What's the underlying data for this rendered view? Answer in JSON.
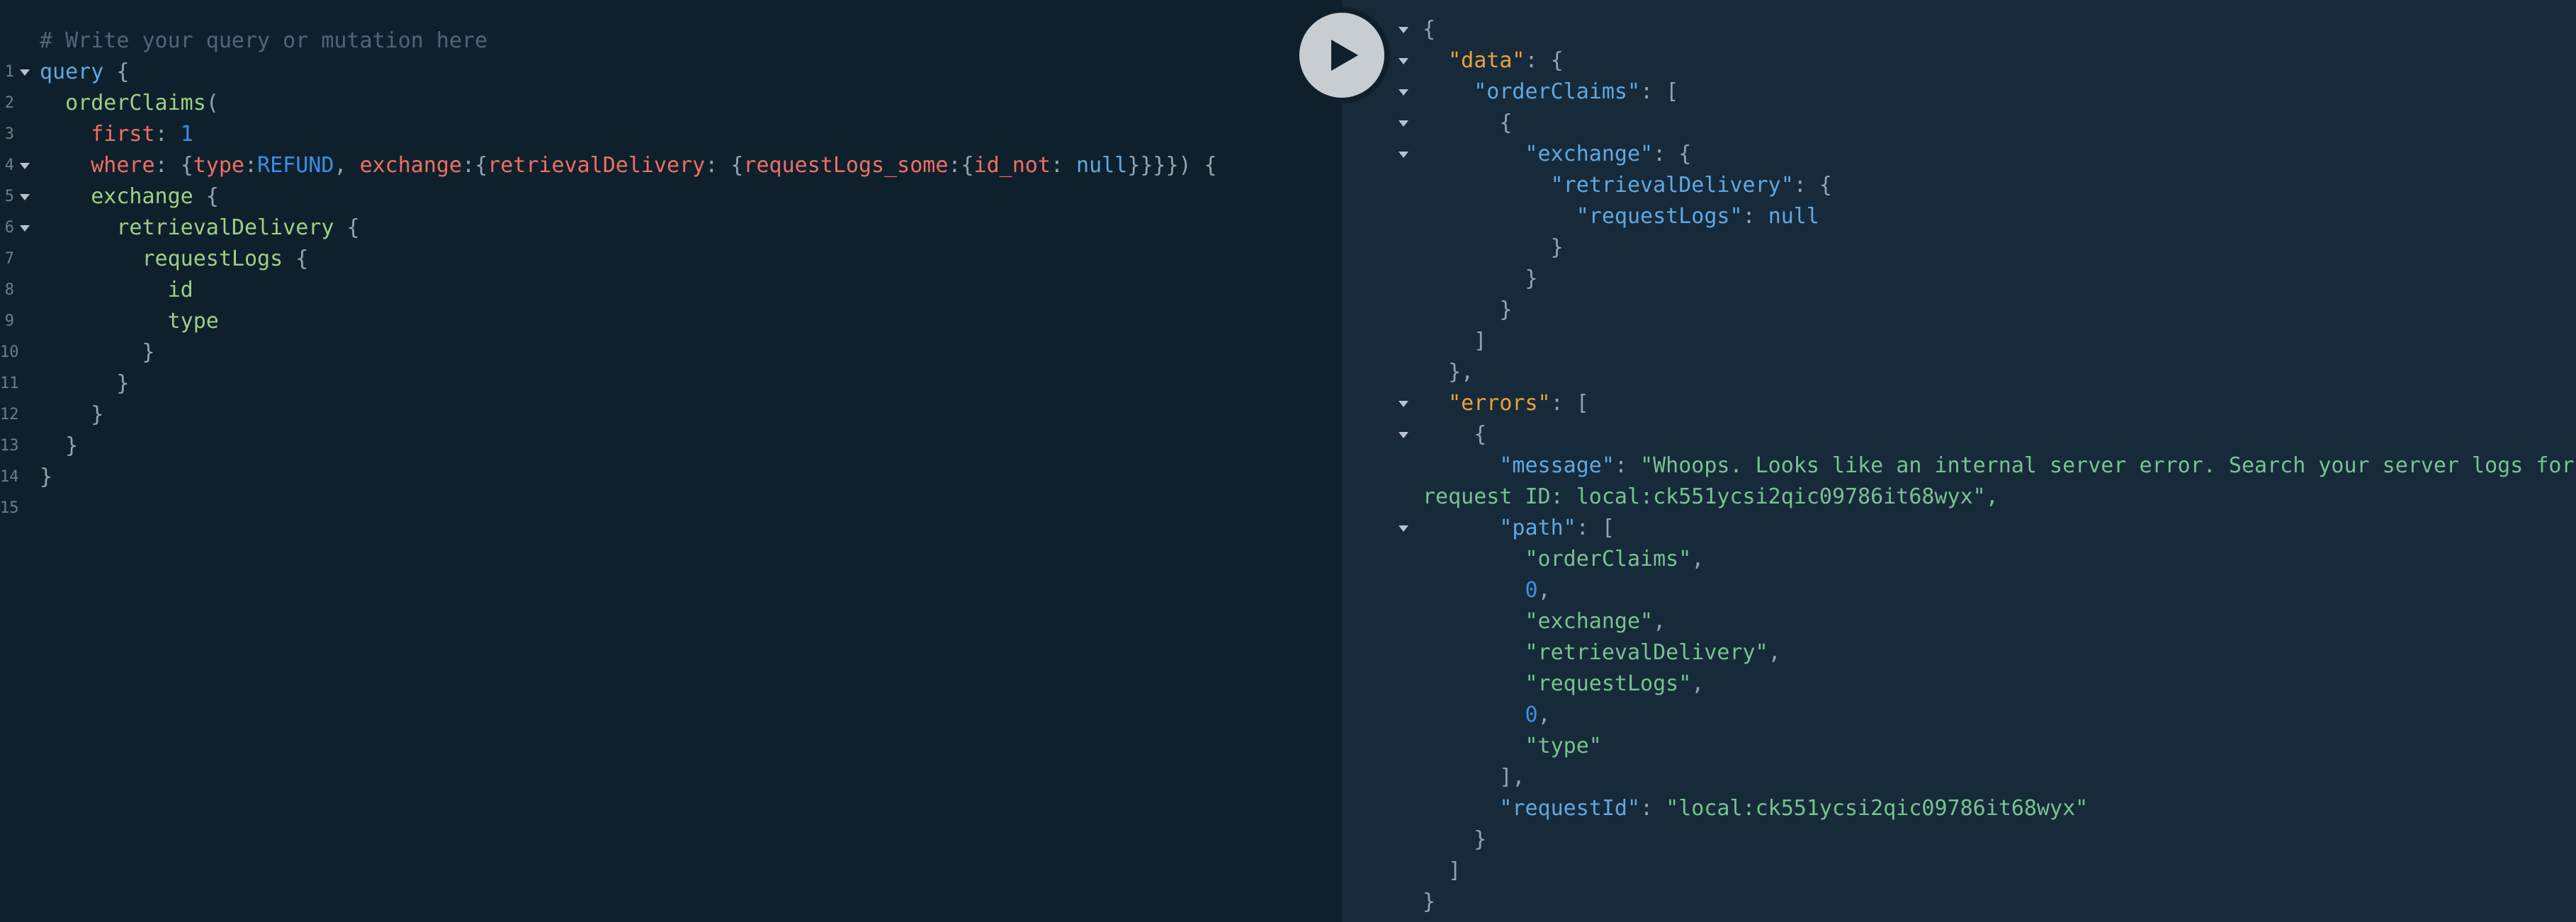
{
  "query_editor": {
    "line_numbers": [
      "1",
      "2",
      "3",
      "4",
      "5",
      "6",
      "7",
      "8",
      "9",
      "10",
      "11",
      "12",
      "13",
      "14",
      "15"
    ],
    "tokens": {
      "comment": "# Write your query or mutation here",
      "query_kw": "query",
      "open_brace": "{",
      "close_brace": "}",
      "order_claims": "orderClaims",
      "open_paren": "(",
      "first_arg": "first",
      "colon": ":",
      "first_value": "1",
      "where_arg": "where",
      "open_brace_inline": "{",
      "type_arg": "type",
      "type_value": "REFUND",
      "comma": ",",
      "exchange_arg": "exchange",
      "retrieval_arg": "retrievalDelivery",
      "request_logs_some_arg": "requestLogs_some",
      "id_not_arg": "id_not",
      "null_value": "null",
      "where_close": "}}}}) {",
      "exchange_field": "exchange",
      "retrieval_field": "retrievalDelivery",
      "request_logs_field": "requestLogs",
      "id_field": "id",
      "type_field": "type"
    }
  },
  "run_button": {
    "icon": "play-icon"
  },
  "result_viewer": {
    "tokens": {
      "open_brace": "{",
      "close_brace": "}",
      "open_bracket": "[",
      "close_bracket": "]",
      "close_brace_comma": "},",
      "close_bracket_comma": "],",
      "colon": ": ",
      "comma": ",",
      "data_key": "\"data\"",
      "order_claims_key": "\"orderClaims\"",
      "exchange_key": "\"exchange\"",
      "retrieval_key": "\"retrievalDelivery\"",
      "request_logs_key": "\"requestLogs\"",
      "null_value": "null",
      "errors_key": "\"errors\"",
      "message_key": "\"message\"",
      "message_value_part1": "\"Whoops. Looks like an internal server error. Search your server logs for",
      "message_value_part2": "request ID: local:ck551ycsi2qic09786it68wyx\",",
      "path_key": "\"path\"",
      "path_items": [
        "\"orderClaims\"",
        "0",
        "\"exchange\"",
        "\"retrievalDelivery\"",
        "\"requestLogs\"",
        "0",
        "\"type\""
      ],
      "request_id_key": "\"requestId\"",
      "request_id_value": "\"local:ck551ycsi2qic09786it68wyx\""
    }
  },
  "colors": {
    "query_bg": "#0f202d",
    "result_bg": "#172a3a",
    "keyword": "#5fa8e0",
    "field": "#9fcf82",
    "argument": "#ee6f63",
    "number": "#3b8fe3",
    "json_key_top": "#e9a13b",
    "json_key": "#5fa8e0",
    "json_string": "#76c38e",
    "comment": "#4f6575",
    "play_button": "#c8cdd2"
  }
}
